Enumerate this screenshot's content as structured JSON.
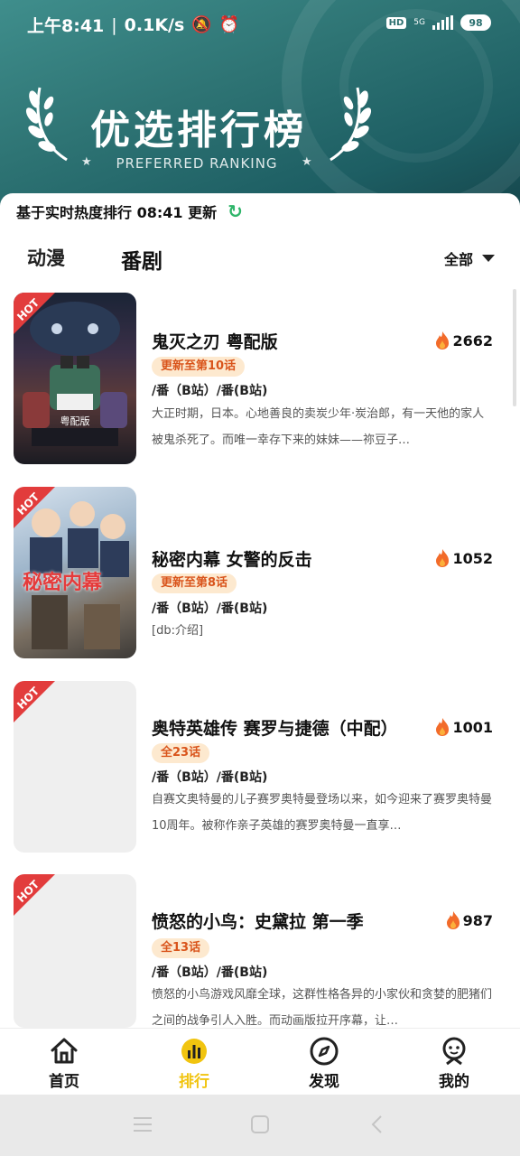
{
  "status_bar": {
    "time": "上午8:41",
    "speed": "0.1K/s",
    "hd": "HD",
    "network": "5G",
    "battery": "98"
  },
  "header": {
    "title": "优选排行榜",
    "subtitle": "PREFERRED RANKING"
  },
  "info": {
    "text": "基于实时热度排行 08:41 更新"
  },
  "tabs": [
    {
      "label": "动漫"
    },
    {
      "label": "番剧"
    }
  ],
  "filter": {
    "label": "全部"
  },
  "items": [
    {
      "title": "鬼灭之刃 粤配版",
      "heat": "2662",
      "badge": "更新至第10话",
      "source": "/番（B站）/番(B站)",
      "desc": "大正时期，日本。心地善良的卖炭少年·炭治郎，有一天他的家人被鬼杀死了。而唯一幸存下来的妹妹——祢豆子…",
      "hot": "HOT",
      "poster_caption": "粤配版"
    },
    {
      "title": "秘密内幕 女警的反击",
      "heat": "1052",
      "badge": "更新至第8话",
      "source": "/番（B站）/番(B站)",
      "desc": "[db:介绍]",
      "hot": "HOT",
      "poster_caption": "秘密内幕"
    },
    {
      "title": "奥特英雄传 赛罗与捷德（中配）",
      "heat": "1001",
      "badge": "全23话",
      "source": "/番（B站）/番(B站)",
      "desc": "自赛文奥特曼的儿子赛罗奥特曼登场以来，如今迎来了赛罗奥特曼10周年。被称作亲子英雄的赛罗奥特曼一直享…",
      "hot": "HOT"
    },
    {
      "title": "愤怒的小鸟：史黛拉 第一季",
      "heat": "987",
      "badge": "全13话",
      "source": "/番（B站）/番(B站)",
      "desc": "愤怒的小鸟游戏风靡全球，这群性格各异的小家伙和贪婪的肥猪们之间的战争引人入胜。而动画版拉开序幕，让…",
      "hot": "HOT"
    }
  ],
  "bottom_nav": [
    {
      "label": "首页",
      "icon": "home-icon"
    },
    {
      "label": "排行",
      "icon": "ranking-icon"
    },
    {
      "label": "发现",
      "icon": "compass-icon"
    },
    {
      "label": "我的",
      "icon": "profile-icon"
    }
  ],
  "colors": {
    "header_teal": "#2e7474",
    "accent_yellow": "#f1c40f",
    "hot_red": "#e23c3c",
    "badge_bg": "#fde9cf",
    "badge_text": "#d9541b",
    "refresh_green": "#2fb56a"
  }
}
